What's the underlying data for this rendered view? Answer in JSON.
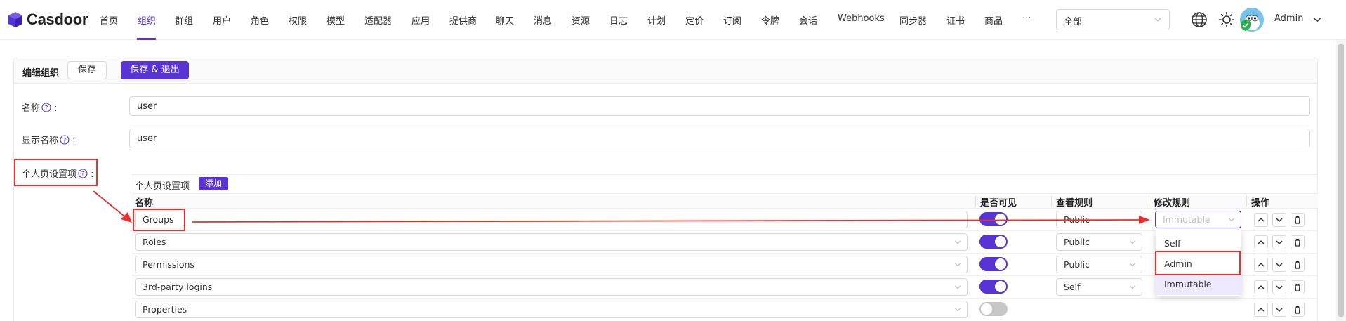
{
  "brand": {
    "name": "Casdoor"
  },
  "nav": {
    "items": [
      {
        "label": "首页"
      },
      {
        "label": "组织"
      },
      {
        "label": "群组"
      },
      {
        "label": "用户"
      },
      {
        "label": "角色"
      },
      {
        "label": "权限"
      },
      {
        "label": "模型"
      },
      {
        "label": "适配器"
      },
      {
        "label": "应用"
      },
      {
        "label": "提供商"
      },
      {
        "label": "聊天"
      },
      {
        "label": "消息"
      },
      {
        "label": "资源"
      },
      {
        "label": "日志"
      },
      {
        "label": "计划"
      },
      {
        "label": "定价"
      },
      {
        "label": "订阅"
      },
      {
        "label": "令牌"
      },
      {
        "label": "会话"
      },
      {
        "label": "Webhooks"
      },
      {
        "label": "同步器"
      },
      {
        "label": "证书"
      },
      {
        "label": "商品"
      },
      {
        "label": "···"
      }
    ],
    "active": "组织"
  },
  "header": {
    "org_select_value": "全部",
    "user_name": "Admin"
  },
  "page": {
    "title": "编辑组织",
    "save_label": "保存",
    "save_exit_label": "保存 & 退出",
    "name_label": "名称",
    "name_value": "user",
    "display_name_label": "显示名称",
    "display_name_value": "user",
    "account_items_label": "个人页设置项",
    "colon": ":"
  },
  "account_table": {
    "title": "个人页设置项",
    "add_label": "添加",
    "columns": {
      "name": "名称",
      "visible": "是否可见",
      "view_rule": "查看规则",
      "modify_rule": "修改规则",
      "actions": "操作"
    },
    "rows": [
      {
        "name": "Groups",
        "visible": true,
        "view_rule": "Public",
        "modify_rule": "Immutable"
      },
      {
        "name": "Roles",
        "visible": true,
        "view_rule": "Public",
        "modify_rule": ""
      },
      {
        "name": "Permissions",
        "visible": true,
        "view_rule": "Public",
        "modify_rule": ""
      },
      {
        "name": "3rd-party logins",
        "visible": true,
        "view_rule": "Self",
        "modify_rule": ""
      },
      {
        "name": "Properties",
        "visible": false,
        "view_rule": "",
        "modify_rule": ""
      }
    ]
  },
  "modify_rule_dropdown": {
    "placeholder": "Immutable",
    "options": [
      {
        "label": "Self"
      },
      {
        "label": "Admin"
      },
      {
        "label": "Immutable"
      }
    ],
    "highlighted": "Admin",
    "selected": "Immutable"
  },
  "colors": {
    "accent": "#5734d3",
    "annotation": "#e8312f",
    "toggle_off": "#c7c7c7"
  }
}
